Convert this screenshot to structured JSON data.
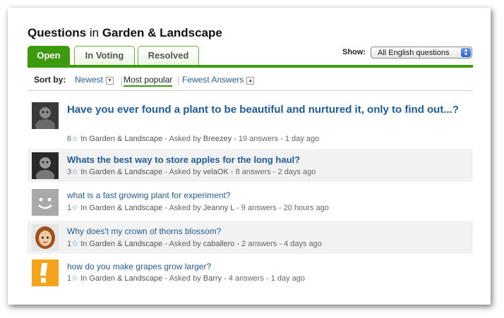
{
  "heading": {
    "bold_a": "Questions",
    "middle": "in",
    "bold_b": "Garden & Landscape"
  },
  "tabs": [
    {
      "label": "Open"
    },
    {
      "label": "In Voting"
    },
    {
      "label": "Resolved"
    }
  ],
  "show": {
    "label": "Show:",
    "selected": "All English questions"
  },
  "sort": {
    "label": "Sort by:",
    "options": [
      {
        "label": "Newest"
      },
      {
        "label": "Most popular"
      },
      {
        "label": "Fewest Answers"
      }
    ]
  },
  "questions": [
    {
      "title": "Have you ever found a plant to be beautiful and nurtured it, only to find out...?",
      "stars": "6",
      "category": "In Garden & Landscape",
      "asked": "- Asked by",
      "user": "Breezey",
      "rest": "- 19 answers - 1 day ago"
    },
    {
      "title": "Whats the best way to store apples for the long haul?",
      "stars": "3",
      "category": "In Garden & Landscape",
      "asked": "- Asked by",
      "user": "velaOK",
      "rest": "- 8 answers - 2 days ago"
    },
    {
      "title": "what is a fast growing plant for experiment?",
      "stars": "1",
      "category": "In Garden & Landscape",
      "asked": "- Asked by",
      "user": "Jeanny L",
      "rest": "- 9 answers - 20 hours ago"
    },
    {
      "title": "Why does't my crown of thorns blossom?",
      "stars": "1",
      "category": "In Garden & Landscape",
      "asked": "- Asked by",
      "user": "caballero",
      "rest": "- 2 answers - 4 days ago"
    },
    {
      "title": "how do you make grapes grow larger?",
      "stars": "1",
      "category": "In Garden & Landscape",
      "asked": "- Asked by",
      "user": "Barry",
      "rest": "- 4 answers - 1 day ago"
    }
  ],
  "colors": {
    "accent_green": "#3c9a0e",
    "link_blue": "#1f5c99"
  }
}
